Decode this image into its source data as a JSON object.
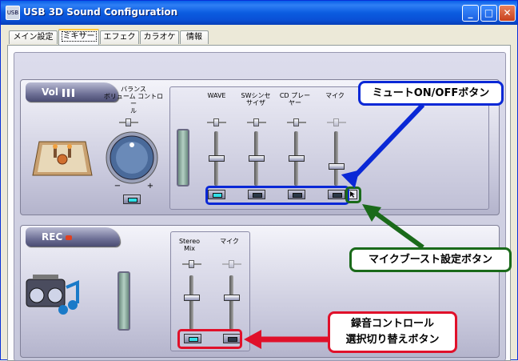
{
  "window": {
    "title": "USB 3D Sound Configuration",
    "icon_label": "USB"
  },
  "title_buttons": {
    "minimize": "_",
    "maximize": "□",
    "close": "✕"
  },
  "tabs": [
    {
      "label": "メイン設定"
    },
    {
      "label": "ミキサー",
      "active": true
    },
    {
      "label": "エフェクト"
    },
    {
      "label": "カラオケ"
    },
    {
      "label": "情報"
    }
  ],
  "vol": {
    "badge": "Vol",
    "balance_label": "バランス\nボリューム コントロー\nル",
    "knob_minus": "−",
    "knob_plus": "+",
    "channels": [
      {
        "label": "WAVE"
      },
      {
        "label": "SWシンセ\nサイザ"
      },
      {
        "label": "CD プレー\nヤー"
      },
      {
        "label": "マイク"
      }
    ]
  },
  "rec": {
    "badge": "REC",
    "channels": [
      {
        "label": "Stereo\nMix"
      },
      {
        "label": "マイク"
      }
    ]
  },
  "annotations": {
    "mute": "ミュートON/OFFボタン",
    "boost": "マイクブースト設定ボタン",
    "rec_select": "録音コントロール\n選択切り替えボタン"
  },
  "colors": {
    "blue": "#0a28d6",
    "green": "#1a6a1a",
    "red": "#e0102a"
  }
}
